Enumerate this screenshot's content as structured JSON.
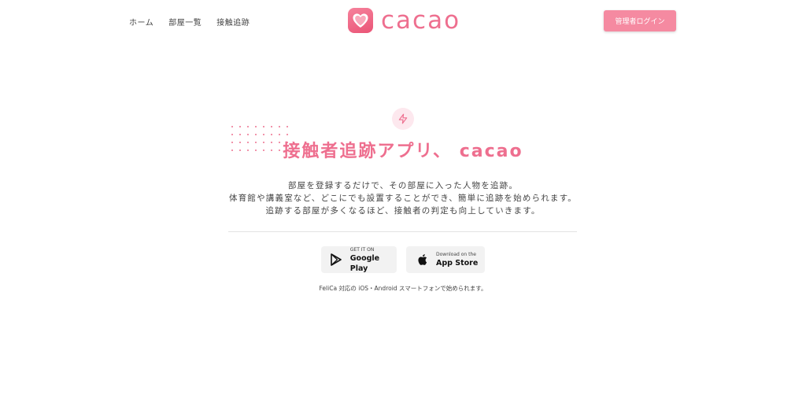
{
  "nav": {
    "items": [
      "ホーム",
      "部屋一覧",
      "接触追跡"
    ]
  },
  "logo": {
    "text": "cacao"
  },
  "header": {
    "admin_login": "管理者ログイン"
  },
  "hero": {
    "icon": "lightning-icon",
    "headline": "接触者追跡アプリ、 cacao",
    "description": [
      "部屋を登録するだけで、その部屋に入った人物を追跡。",
      "体育館や講義室など、どこにでも設置することができ、簡単に追跡を始められます。",
      "追跡する部屋が多くなるほど、接触者の判定も向上していきます。"
    ]
  },
  "stores": {
    "google": {
      "small": "GET IT ON",
      "big": "Google Play"
    },
    "apple": {
      "small": "Download on the",
      "big": "App Store"
    }
  },
  "note": "FeliCa 対応の iOS・Android スマートフォンで始められます。",
  "colors": {
    "accent": "#ee6f8f",
    "button": "#f58aa1",
    "icon_bg": "#fde8ee"
  }
}
